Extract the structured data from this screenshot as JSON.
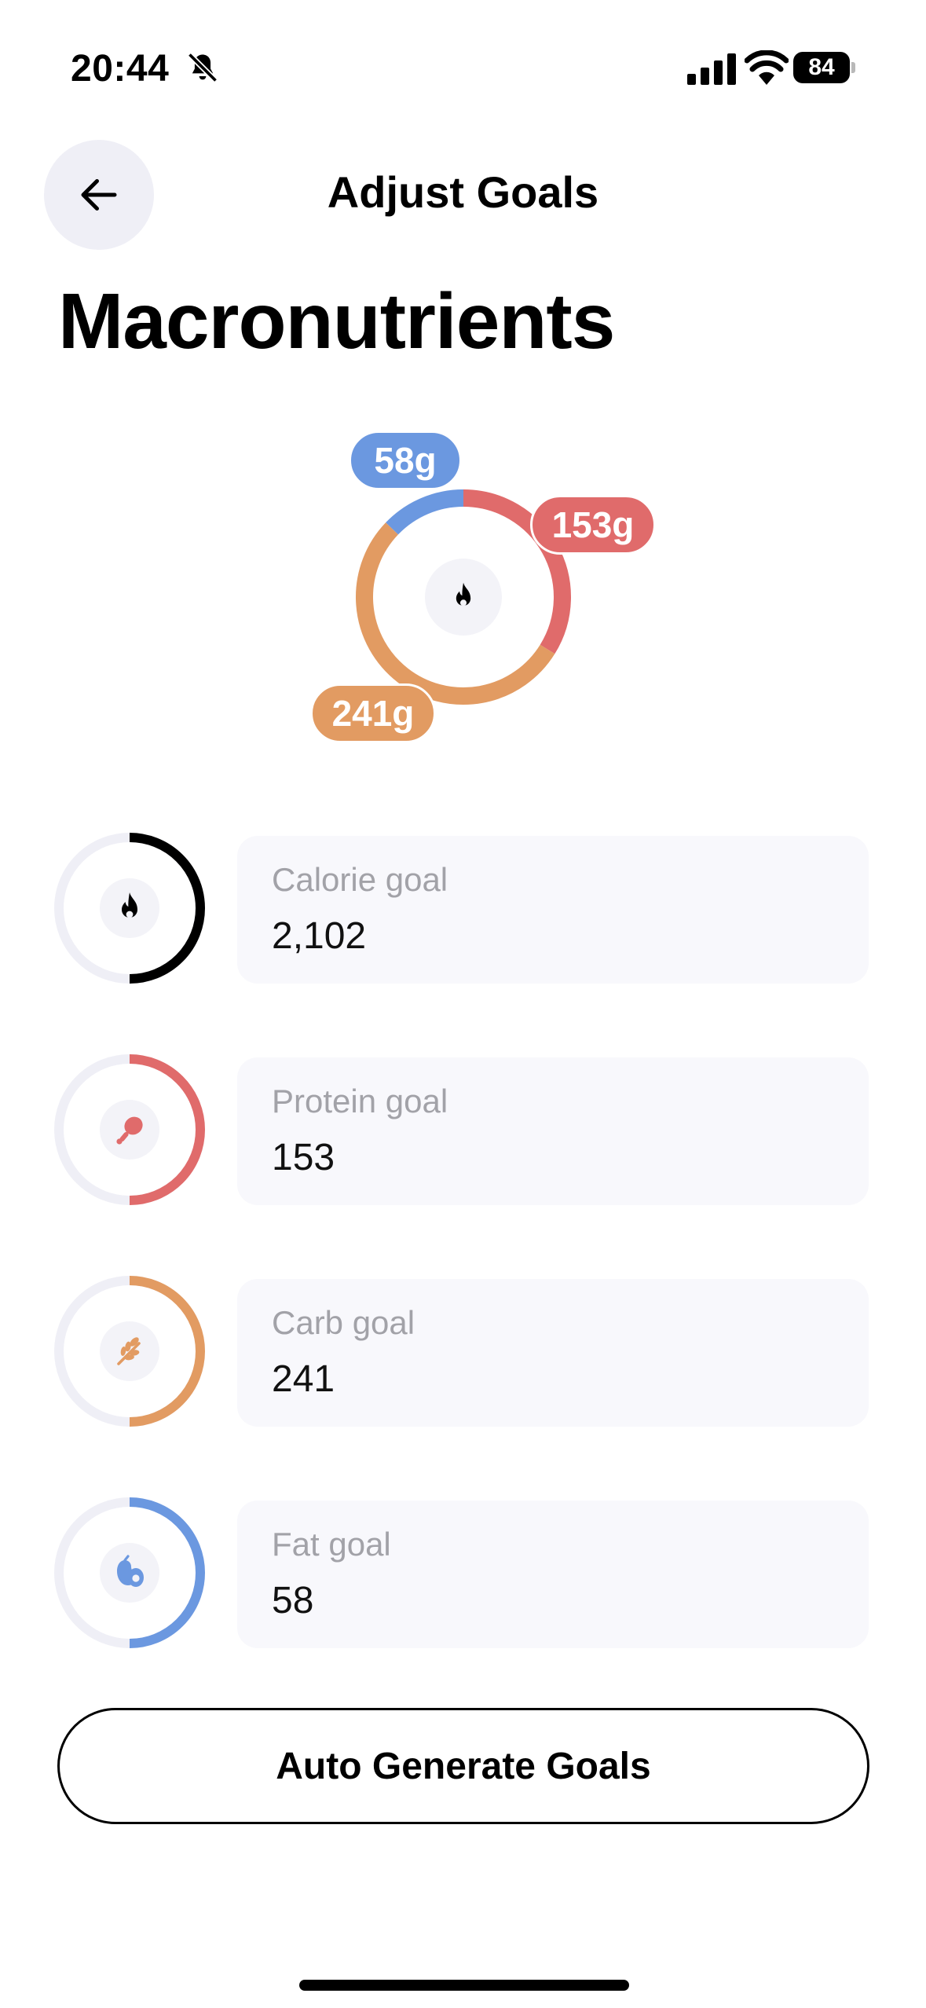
{
  "status_bar": {
    "time": "20:44",
    "battery": "84",
    "icons": [
      "bell-slash-icon",
      "cellular-signal-icon",
      "wifi-icon",
      "battery-icon"
    ]
  },
  "header": {
    "back_icon": "arrow-left-icon",
    "title": "Adjust Goals"
  },
  "page_title": "Macronutrients",
  "chart_data": {
    "type": "donut",
    "center_icon": "flame-icon",
    "slices": [
      {
        "name": "Protein",
        "value": 153,
        "label": "153g",
        "color": "#e06b6b"
      },
      {
        "name": "Carb",
        "value": 241,
        "label": "241g",
        "color": "#e29b62"
      },
      {
        "name": "Fat",
        "value": 58,
        "label": "58g",
        "color": "#6b98e0"
      }
    ]
  },
  "goals": [
    {
      "label": "Calorie goal",
      "value": "2,102",
      "icon": "flame-icon",
      "color": "#000000",
      "ring_fraction": 0.5
    },
    {
      "label": "Protein goal",
      "value": "153",
      "icon": "drumstick-icon",
      "color": "#e06b6b",
      "ring_fraction": 0.5
    },
    {
      "label": "Carb goal",
      "value": "241",
      "icon": "wheat-icon",
      "color": "#e29b62",
      "ring_fraction": 0.5
    },
    {
      "label": "Fat goal",
      "value": "58",
      "icon": "avocado-icon",
      "color": "#6b98e0",
      "ring_fraction": 0.5
    }
  ],
  "auto_generate_label": "Auto Generate Goals"
}
